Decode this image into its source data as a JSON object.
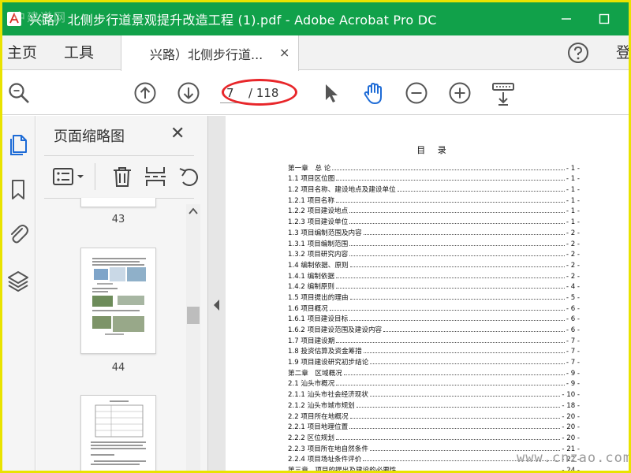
{
  "window": {
    "title": "兴路）北侧步行道景观提升改造工程 (1).pdf - Adobe Acrobat Pro DC",
    "watermark_top": "中建道网",
    "accent": "#11a14a"
  },
  "tabs": {
    "home": "主页",
    "tools": "工具",
    "doc_tab": "兴路）北侧步行道...",
    "close_glyph": "×",
    "signin": "登"
  },
  "toolbar": {
    "current_page": "7",
    "total_pages": "/ 118"
  },
  "thumbnails": {
    "title": "页面缩略图",
    "close_glyph": "✕",
    "pages": [
      "43",
      "44"
    ]
  },
  "document": {
    "toc_title": "目 录",
    "toc": [
      {
        "text": "第一章　总 论",
        "page": "- 1 -"
      },
      {
        "text": "1.1 项目区位图",
        "page": "- 1 -"
      },
      {
        "text": "1.2 项目名称、建设地点及建设单位",
        "page": "- 1 -"
      },
      {
        "text": "1.2.1 项目名称",
        "page": "- 1 -"
      },
      {
        "text": "1.2.2 项目建设地点",
        "page": "- 1 -"
      },
      {
        "text": "1.2.3 项目建设单位",
        "page": "- 1 -"
      },
      {
        "text": "1.3 项目编制范围及内容",
        "page": "- 2 -"
      },
      {
        "text": "1.3.1 项目编制范围",
        "page": "- 2 -"
      },
      {
        "text": "1.3.2 项目研究内容",
        "page": "- 2 -"
      },
      {
        "text": "1.4 编制依据、原则",
        "page": "- 2 -"
      },
      {
        "text": "1.4.1 编制依据",
        "page": "- 2 -"
      },
      {
        "text": "1.4.2 编制原则",
        "page": "- 4 -"
      },
      {
        "text": "1.5 项目提出的理由",
        "page": "- 5 -"
      },
      {
        "text": "1.6 项目概况",
        "page": "- 6 -"
      },
      {
        "text": "1.6.1 项目建设目标",
        "page": "- 6 -"
      },
      {
        "text": "1.6.2 项目建设范围及建设内容",
        "page": "- 6 -"
      },
      {
        "text": "1.7 项目建设期",
        "page": "- 7 -"
      },
      {
        "text": "1.8 投资估算及资金筹措",
        "page": "- 7 -"
      },
      {
        "text": "1.9 项目建设研究初步结论",
        "page": "- 7 -"
      },
      {
        "text": "第二章　区域概况",
        "page": "- 9 -"
      },
      {
        "text": "2.1 汕头市概况",
        "page": "- 9 -"
      },
      {
        "text": "2.1.1 汕头市社会经济现状",
        "page": "- 10 -"
      },
      {
        "text": "2.1.2 汕头市城市规划",
        "page": "- 18 -"
      },
      {
        "text": "2.2 项目所在地概况",
        "page": "- 20 -"
      },
      {
        "text": "2.2.1 项目地理位置",
        "page": "- 20 -"
      },
      {
        "text": "2.2.2 区位规划",
        "page": "- 20 -"
      },
      {
        "text": "2.2.3 项目所在地自然条件",
        "page": "- 21 -"
      },
      {
        "text": "2.2.4 项目场址条件评价",
        "page": "- 22 -"
      },
      {
        "text": "第三章　项目的提出及建设的必要性",
        "page": "- 24 -"
      }
    ]
  },
  "watermark_bottom": "www.cnzao.com"
}
